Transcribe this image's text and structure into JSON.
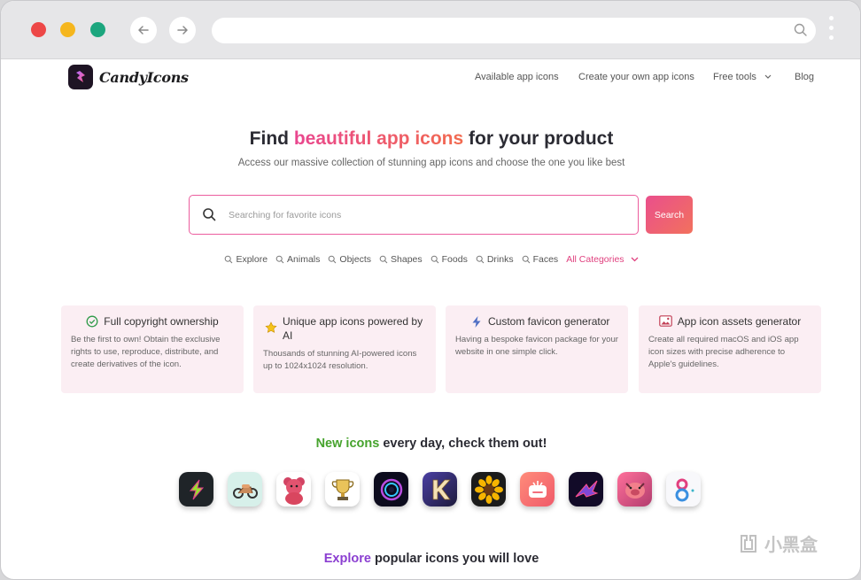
{
  "browser": {
    "colors": {
      "red": "#ed4747",
      "yellow": "#f5b61e",
      "green": "#1ca67e"
    },
    "back_icon": "arrow-left-icon",
    "forward_icon": "arrow-right-icon",
    "url": ""
  },
  "site": {
    "logo_text": "CandyIcons",
    "nav": {
      "available": "Available app icons",
      "create": "Create your own app icons",
      "free_tools": "Free tools",
      "blog": "Blog"
    }
  },
  "hero": {
    "title_before": "Find ",
    "title_highlight": "beautiful app icons",
    "title_after": " for your product",
    "subtitle": "Access our massive collection of stunning app icons and choose the one you like best"
  },
  "search": {
    "placeholder": "Searching for favorite icons",
    "button_label": "Search"
  },
  "categories": [
    "Explore",
    "Animals",
    "Objects",
    "Shapes",
    "Foods",
    "Drinks",
    "Faces"
  ],
  "all_categories_label": "All Categories",
  "features": [
    {
      "title": "Full copyright ownership",
      "icon": "check-circle-icon",
      "body": "Be the first to own! Obtain the exclusive rights to use, reproduce, distribute, and create derivatives of the icon."
    },
    {
      "title": "Unique app icons powered by AI",
      "icon": "star-icon",
      "body": "Thousands of stunning AI-powered icons up to 1024x1024 resolution."
    },
    {
      "title": "Custom favicon generator",
      "icon": "lightning-icon",
      "body": "Having a bespoke favicon package for your website in one simple click."
    },
    {
      "title": "App icon assets generator",
      "icon": "image-icon",
      "body": "Create all required macOS and iOS app icon sizes with precise adherence to Apple's guidelines."
    }
  ],
  "new_icons": {
    "highlight": "New icons",
    "rest": " every day, check them out!"
  },
  "icon_names": [
    "lightning-app-icon",
    "motorcycle-app-icon",
    "teddy-bear-app-icon",
    "trophy-app-icon",
    "lens-app-icon",
    "letter-k-app-icon",
    "sunflower-app-icon",
    "robot-app-icon",
    "bird-app-icon",
    "pig-app-icon",
    "number-8-app-icon"
  ],
  "explore": {
    "highlight": "Explore",
    "rest": " popular icons you will love"
  },
  "watermark": "小黑盒"
}
